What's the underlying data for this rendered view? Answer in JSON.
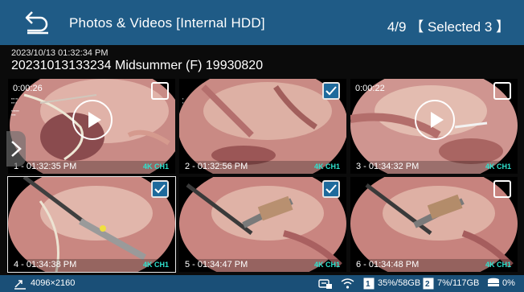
{
  "header": {
    "title": "Photos & Videos [Internal HDD]",
    "page": "4/9",
    "selected": "【 Selected 3 】"
  },
  "info": {
    "datetime": "2023/10/13 01:32:34 PM",
    "folder_name": "20231013133234 Midsummer (F) 19930820"
  },
  "tiles": [
    {
      "label": "1 - 01:32:35 PM",
      "resolution": "4K CH1",
      "duration": "0:00:26",
      "type": "video",
      "checked": false
    },
    {
      "label": "2 - 01:32:56 PM",
      "resolution": "4K CH1",
      "duration": "",
      "type": "photo",
      "checked": true
    },
    {
      "label": "3 - 01:34:32 PM",
      "resolution": "4K CH1",
      "duration": "0:00:22",
      "type": "video",
      "checked": false
    },
    {
      "label": "4 - 01:34:38 PM",
      "resolution": "4K CH1",
      "duration": "",
      "type": "photo",
      "checked": true
    },
    {
      "label": "5 - 01:34:47 PM",
      "resolution": "4K CH1",
      "duration": "",
      "type": "photo",
      "checked": true
    },
    {
      "label": "6 - 01:34:48 PM",
      "resolution": "4K CH1",
      "duration": "",
      "type": "photo",
      "checked": false
    }
  ],
  "status": {
    "resolution": "4096×2160",
    "disk1": "35%/58GB",
    "disk2": "7%/117GB",
    "network": "0%"
  },
  "colors": {
    "titlebar": "#1f5b86",
    "statusbar": "#1a4f77",
    "checkbox_checked": "#1e6a9c",
    "resolution_badge": "#2fe3cf"
  }
}
